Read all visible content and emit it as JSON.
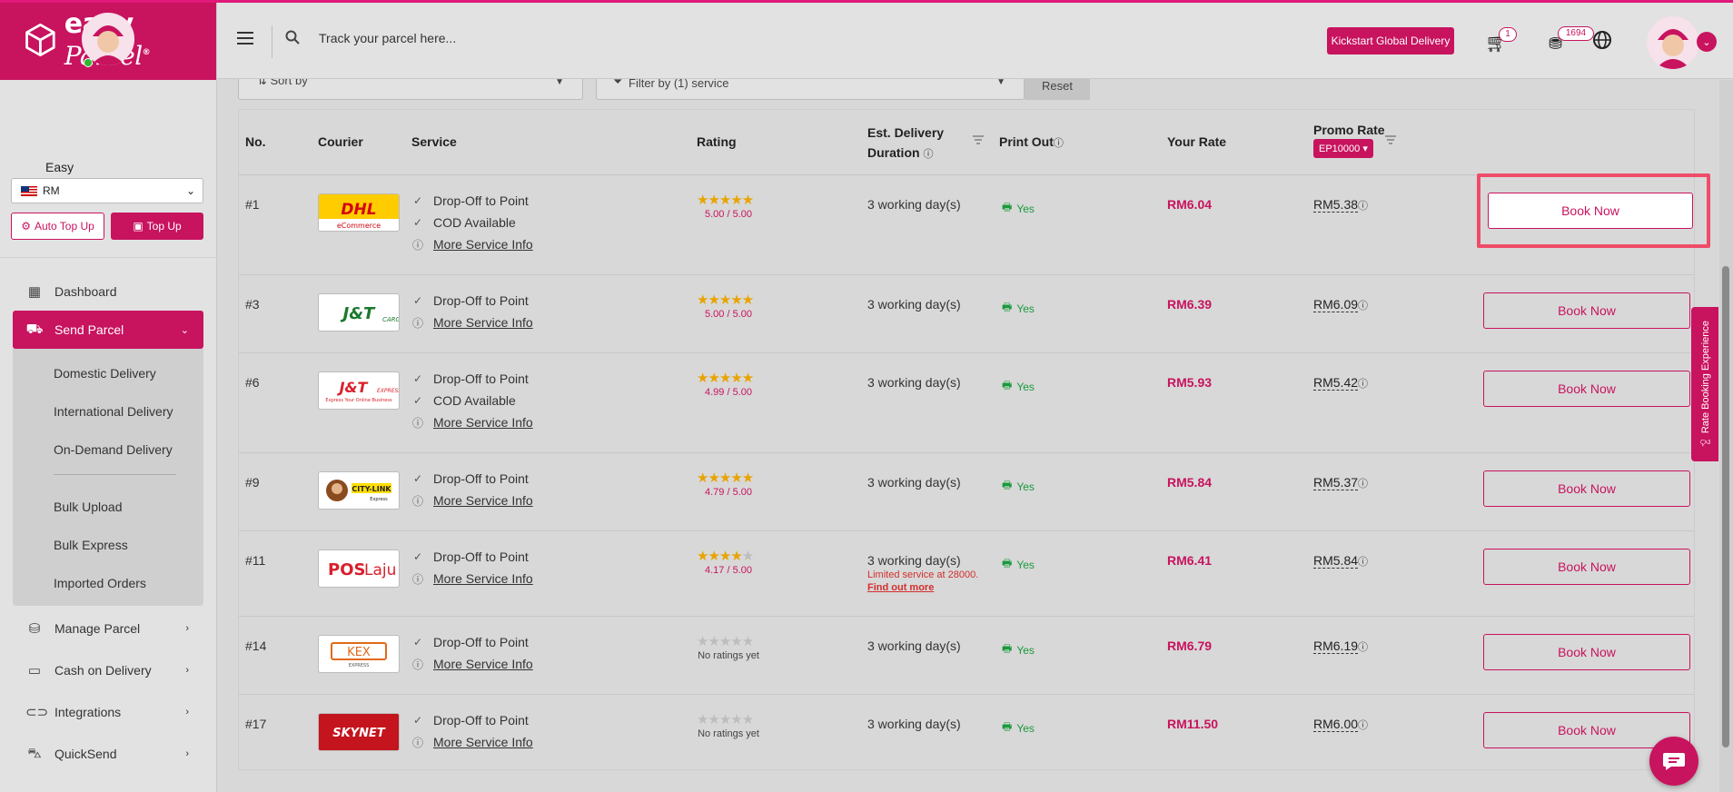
{
  "brand": {
    "logo_text": "easy",
    "logo_script": "Parcel",
    "reg": "®"
  },
  "user": {
    "name": "Easy",
    "currency": "RM"
  },
  "wallet": {
    "auto_topup": "Auto Top Up",
    "topup": "Top Up"
  },
  "nav": {
    "dashboard": "Dashboard",
    "send_parcel": "Send Parcel",
    "sub": [
      "Domestic Delivery",
      "International Delivery",
      "On-Demand Delivery",
      "Bulk Upload",
      "Bulk Express",
      "Imported Orders"
    ],
    "manage_parcel": "Manage Parcel",
    "cod": "Cash on Delivery",
    "integrations": "Integrations",
    "quicksend": "QuickSend"
  },
  "header": {
    "search_placeholder": "Track your parcel here...",
    "kickstart": "Kickstart Global Delivery",
    "cart_count": "1",
    "points": "1694"
  },
  "filters": {
    "sort": "Sort by",
    "service": "Filter by (1) service",
    "reset": "Reset"
  },
  "table": {
    "headers": {
      "no": "No.",
      "courier": "Courier",
      "service": "Service",
      "rating": "Rating",
      "duration_1": "Est. Delivery",
      "duration_2": "Duration",
      "print_out": "Print Out",
      "your_rate": "Your Rate",
      "promo_rate": "Promo Rate",
      "promo_code": "EP10000"
    },
    "book_label": "Book Now",
    "rows": [
      {
        "no": "#1",
        "courier": "DHL eCommerce",
        "services": [
          "Drop-Off to Point",
          "COD Available"
        ],
        "more": "More Service Info",
        "stars": 5,
        "rating": "5.00 / 5.00",
        "duration": "3 working day(s)",
        "print": "Yes",
        "rate": "RM6.04",
        "promo": "RM5.38"
      },
      {
        "no": "#3",
        "courier": "J&T Cargo",
        "services": [
          "Drop-Off to Point"
        ],
        "more": "More Service Info",
        "stars": 5,
        "rating": "5.00 / 5.00",
        "duration": "3 working day(s)",
        "print": "Yes",
        "rate": "RM6.39",
        "promo": "RM6.09"
      },
      {
        "no": "#6",
        "courier": "J&T Express",
        "services": [
          "Drop-Off to Point",
          "COD Available"
        ],
        "more": "More Service Info",
        "stars": 5,
        "rating": "4.99 / 5.00",
        "duration": "3 working day(s)",
        "print": "Yes",
        "rate": "RM5.93",
        "promo": "RM5.42"
      },
      {
        "no": "#9",
        "courier": "City-Link Express",
        "services": [
          "Drop-Off to Point"
        ],
        "more": "More Service Info",
        "stars": 5,
        "rating": "4.79 / 5.00",
        "duration": "3 working day(s)",
        "print": "Yes",
        "rate": "RM5.84",
        "promo": "RM5.37"
      },
      {
        "no": "#11",
        "courier": "Pos Laju",
        "services": [
          "Drop-Off to Point"
        ],
        "more": "More Service Info",
        "stars": 4,
        "rating": "4.17 / 5.00",
        "duration": "3 working day(s)",
        "limited": "Limited service at 28000.",
        "findout": "Find out more",
        "print": "Yes",
        "rate": "RM6.41",
        "promo": "RM5.84"
      },
      {
        "no": "#14",
        "courier": "KEX Express",
        "services": [
          "Drop-Off to Point"
        ],
        "more": "More Service Info",
        "stars": 0,
        "rating": "No ratings yet",
        "duration": "3 working day(s)",
        "print": "Yes",
        "rate": "RM6.79",
        "promo": "RM6.19"
      },
      {
        "no": "#17",
        "courier": "SkyNet",
        "services": [
          "Drop-Off to Point"
        ],
        "more": "More Service Info",
        "stars": 0,
        "rating": "No ratings yet",
        "duration": "3 working day(s)",
        "print": "Yes",
        "rate": "RM11.50",
        "promo": "RM6.00"
      }
    ]
  },
  "feedback_tab": "Rate Booking Experience",
  "colors": {
    "brand": "#c8135f",
    "highlight": "#ef4c6a",
    "success": "#1a9a3c"
  }
}
